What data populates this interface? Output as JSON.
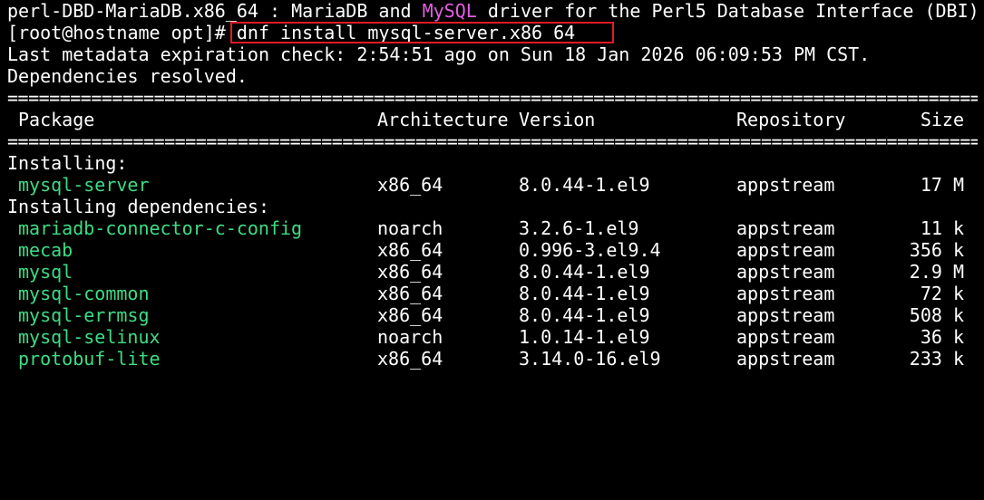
{
  "terminal": {
    "line0": {
      "pkg": "perl-DBD-MariaDB.x86_64",
      "sep": " : MariaDB and ",
      "mysql_word": "MySQL",
      "rest": " driver for the Perl5 Database Interface (DBI)"
    },
    "prompt": "[root@hostname opt]# ",
    "command": "dnf install mysql-server.x86_64",
    "metadata_line": "Last metadata expiration check: 2:54:51 ago on Sun 18 Jan 2026 06:09:53 PM CST.",
    "deps_resolved": "Dependencies resolved.",
    "rule": "================================================================================================",
    "header": {
      "package": "Package",
      "arch": "Architecture",
      "version": "Version",
      "repo": "Repository",
      "size": "Size"
    },
    "installing_label": "Installing:",
    "installing": [
      {
        "name": "mysql-server",
        "arch": "x86_64",
        "version": "8.0.44-1.el9",
        "repo": "appstream",
        "size": "17 M"
      }
    ],
    "deps_label": "Installing dependencies:",
    "dependencies": [
      {
        "name": "mariadb-connector-c-config",
        "arch": "noarch",
        "version": "3.2.6-1.el9",
        "repo": "appstream",
        "size": "11 k"
      },
      {
        "name": "mecab",
        "arch": "x86_64",
        "version": "0.996-3.el9.4",
        "repo": "appstream",
        "size": "356 k"
      },
      {
        "name": "mysql",
        "arch": "x86_64",
        "version": "8.0.44-1.el9",
        "repo": "appstream",
        "size": "2.9 M"
      },
      {
        "name": "mysql-common",
        "arch": "x86_64",
        "version": "8.0.44-1.el9",
        "repo": "appstream",
        "size": "72 k"
      },
      {
        "name": "mysql-errmsg",
        "arch": "x86_64",
        "version": "8.0.44-1.el9",
        "repo": "appstream",
        "size": "508 k"
      },
      {
        "name": "mysql-selinux",
        "arch": "noarch",
        "version": "1.0.14-1.el9",
        "repo": "appstream",
        "size": "36 k"
      },
      {
        "name": "protobuf-lite",
        "arch": "x86_64",
        "version": "3.14.0-16.el9",
        "repo": "appstream",
        "size": "233 k"
      }
    ],
    "colors": {
      "background": "#000000",
      "text": "#ffffff",
      "package_name": "#3ddc84",
      "mysql_highlight": "#e35ee3",
      "annotation_box": "#e01b24"
    }
  }
}
